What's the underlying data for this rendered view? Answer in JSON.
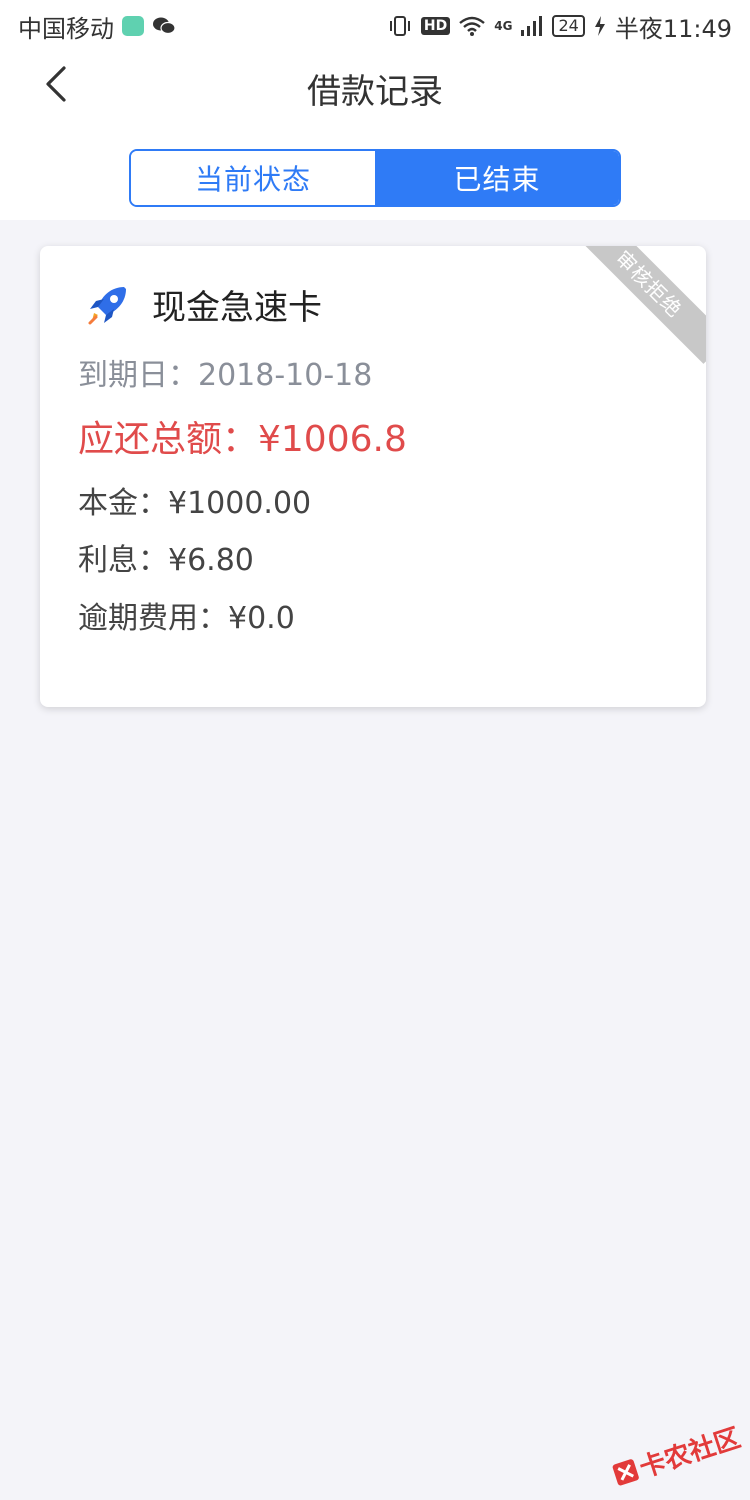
{
  "status_bar": {
    "carrier": "中国移动",
    "network": "4G",
    "battery": "24",
    "time": "半夜11:49",
    "hd": "HD"
  },
  "header": {
    "title": "借款记录",
    "tabs": [
      {
        "label": "当前状态",
        "active": false
      },
      {
        "label": "已结束",
        "active": true
      }
    ]
  },
  "card": {
    "title": "现金急速卡",
    "status_ribbon": "审核拒绝",
    "due_date": "到期日：2018-10-18",
    "total_due": "应还总额：¥1006.8",
    "principal": "本金：¥1000.00",
    "interest": "利息：¥6.80",
    "overdue_fee": "逾期费用：¥0.0"
  },
  "watermark": {
    "text": "卡农社区"
  },
  "colors": {
    "accent": "#2f7bf6",
    "danger": "#e04b4b",
    "muted": "#8a8f99",
    "background": "#f4f4f9"
  }
}
